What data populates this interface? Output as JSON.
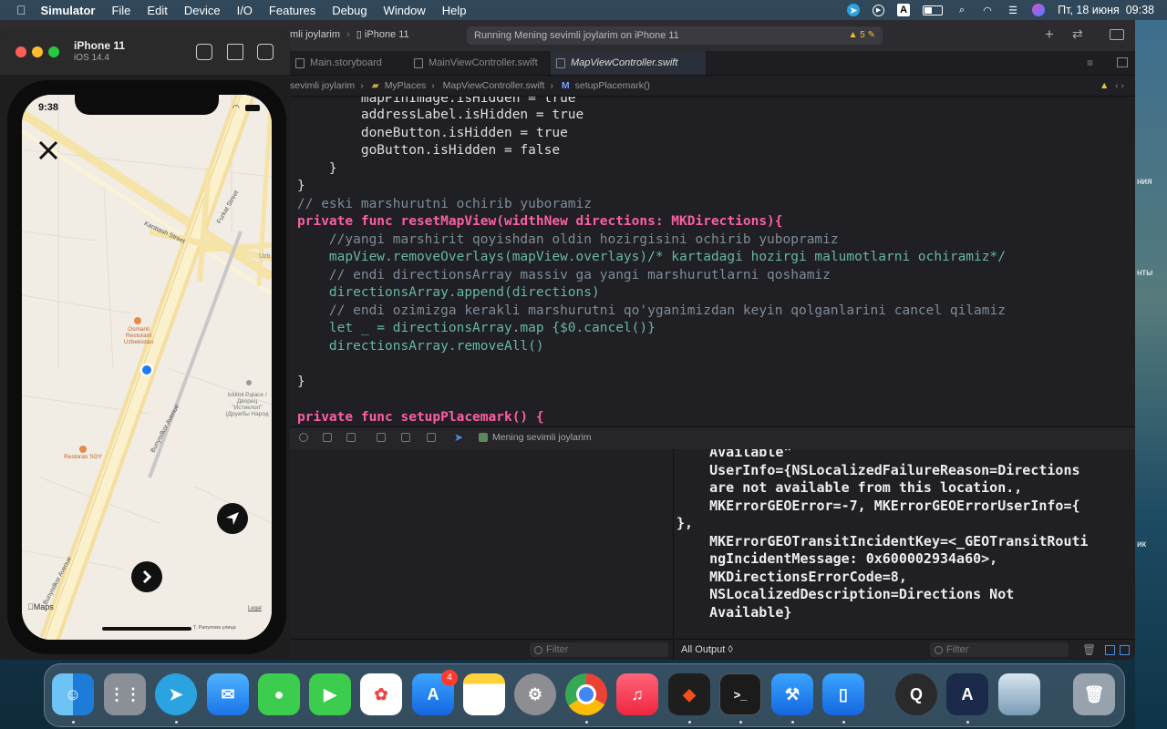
{
  "menubar": {
    "app": "Simulator",
    "items": [
      "File",
      "Edit",
      "Device",
      "I/O",
      "Features",
      "Debug",
      "Window",
      "Help"
    ],
    "datetime": "Пт, 18 июня  09:38"
  },
  "xcode": {
    "scheme": "Mening sevimli joylarim",
    "scheme_short": "mli joylarim",
    "device": "iPhone 11",
    "status": "Running Mening sevimli joylarim on iPhone 11",
    "warnings": "5",
    "tabs": [
      "Main.storyboard",
      "MainViewController.swift",
      "MapViewController.swift"
    ],
    "jumpbar": [
      "sevimli joylarim",
      "MyPlaces",
      "MapViewController.swift",
      "setupPlacemark()"
    ],
    "debug_target": "Mening sevimli joylarim",
    "code": [
      "        mapPinImage.isHidden = true",
      "        addressLabel.isHidden = true",
      "        doneButton.isHidden = true",
      "        goButton.isHidden = false",
      "    }",
      "}",
      "// eski marshurutni ochirib yuboramiz",
      "private func resetMapView(widthNew directions: MKDirections){",
      "    //yangi marshirit qoyishdan oldin hozirgisini ochirib yubopramiz",
      "    mapView.removeOverlays(mapView.overlays)/* kartadagi hozirgi malumotlarni ochiramiz*/",
      "    // endi directionsArray massiv ga yangi marshurutlarni qoshamiz",
      "    directionsArray.append(directions)",
      "    // endi ozimizga kerakli marshurutni qo'yganimizdan keyin qolganlarini cancel qilamiz",
      "    let _ = directionsArray.map {$0.cancel()}",
      "    directionsArray.removeAll()",
      "",
      "}",
      "",
      "private func setupPlacemark() {"
    ],
    "console": [
      "    Available\"",
      "    UserInfo={NSLocalizedFailureReason=Directions",
      "    are not available from this location.,",
      "    MKErrorGEOError=-7, MKErrorGEOErrorUserInfo={",
      "},",
      "    MKErrorGEOTransitIncidentKey=<_GEOTransitRouti",
      "    ngIncidentMessage: 0x600002934a60>,",
      "    MKDirectionsErrorCode=8,",
      "    NSLocalizedDescription=Directions Not",
      "    Available}"
    ],
    "filter_placeholder": "Filter",
    "output_selector": "All Output ◊"
  },
  "simulator": {
    "device_name": "iPhone 11",
    "os": "iOS 14.4",
    "time": "9:38",
    "map": {
      "streets": [
        "Karatash Street",
        "Furkat Street",
        "Bunyodkor Avenue",
        "Bunyodkor Avenue"
      ],
      "poi": [
        {
          "name": "Osmanli Resturant Uzbekistan"
        },
        {
          "name": "Restoran SOY"
        },
        {
          "name": "Istiklol Palace / Дворец \"Истиклол\" (Дружбы Народ"
        }
      ],
      "edge_label": "Uzb",
      "bottom_label": "Т. Рапупова улица",
      "legal": "Legal",
      "maps_brand": "Maps"
    }
  },
  "desktop": {
    "labels": [
      "ния",
      "нты",
      "ик"
    ]
  },
  "dock": {
    "apps": [
      "Finder",
      "Launchpad",
      "Telegram",
      "Mail",
      "Messages",
      "FaceTime",
      "Photos",
      "App Store",
      "Notes",
      "System Preferences",
      "Google Chrome",
      "Music",
      "Figma",
      "Terminal",
      "Xcode",
      "Simulator",
      "QuickTime Player",
      "Instruments",
      "Preview",
      "Trash"
    ],
    "app_store_badge": "4"
  },
  "colors": {
    "keyword": "#fc5fa3",
    "function": "#67b7a4",
    "type": "#d0a8ff",
    "comment": "#7f8c98"
  }
}
